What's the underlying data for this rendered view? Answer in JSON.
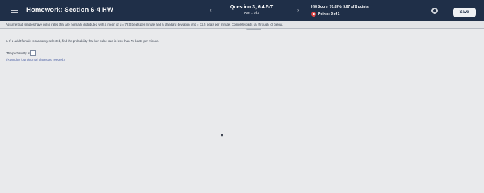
{
  "header": {
    "title": "Homework: Section 6-4 HW",
    "question_title": "Question 3, 6.4.5-T",
    "question_part": "Part 1 of 3",
    "score": "HW Score: 70.83%, 5.67 of 8 points",
    "points": "Points: 0 of 1",
    "save_label": "Save",
    "prev_glyph": "‹",
    "next_glyph": "›"
  },
  "problem": {
    "statement": "Assume that females have pulse rates that are normally distributed with a mean of μ = 72.0 beats per minute and a standard deviation of σ = 12.5 beats per minute. Complete parts (a) through (c) below."
  },
  "part_a": {
    "question": "a. If 1 adult female is randomly selected, find the probability that her pulse rate is less than 75 beats per minute.",
    "answer_prefix": "The probability is",
    "answer_value": "",
    "hint": "(Round to four decimal places as needed.)"
  },
  "colors": {
    "header_bg": "#1f2f48",
    "content_bg": "#e9eaec",
    "points_icon": "#e24444",
    "hint_text": "#4f63a6"
  },
  "icons": [
    "menu-icon",
    "chevron-left-icon",
    "chevron-right-icon",
    "points-status-icon",
    "gear-icon",
    "cursor-icon"
  ]
}
